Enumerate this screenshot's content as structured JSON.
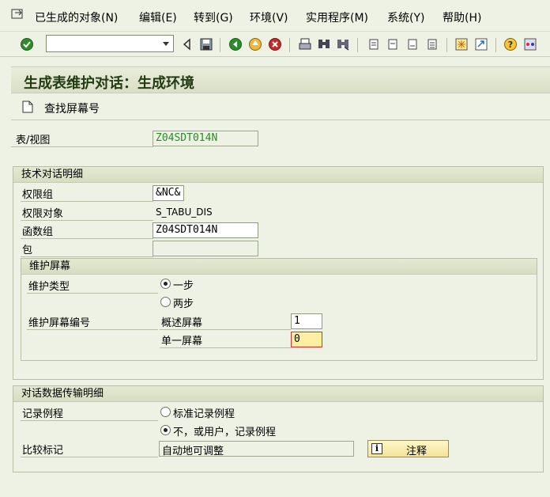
{
  "menu": {
    "items": [
      "已生成的对象(N)",
      "编辑(E)",
      "转到(G)",
      "环境(V)",
      "实用程序(M)",
      "系统(Y)",
      "帮助(H)"
    ]
  },
  "toolbar": {
    "command_value": "",
    "icons": [
      "check-icon",
      "back-icon",
      "save-icon",
      "nav-back-icon",
      "exit-icon",
      "cancel-icon",
      "print-icon",
      "find-icon",
      "find-next-icon",
      "first-page-icon",
      "prev-page-icon",
      "next-page-icon",
      "last-page-icon",
      "create-session-icon",
      "shortcut-icon",
      "help-icon",
      "layout-icon"
    ]
  },
  "title": "生成表维护对话：生成环境",
  "app_toolbar": {
    "find_screen_label": "查找屏幕号"
  },
  "table_view": {
    "label": "表/视图",
    "value": "Z04SDT014N"
  },
  "tech_group": {
    "title": "技术对话明细",
    "auth_group_label": "权限组",
    "auth_group_value": "&NC&",
    "auth_object_label": "权限对象",
    "auth_object_value": "S_TABU_DIS",
    "function_group_label": "函数组",
    "function_group_value": "Z04SDT014N",
    "package_label": "包",
    "package_value": ""
  },
  "maint_screen": {
    "title": "维护屏幕",
    "type_label": "维护类型",
    "one_step_label": "一步",
    "two_step_label": "两步",
    "screen_no_label": "维护屏幕编号",
    "overview_label": "概述屏幕",
    "overview_value": "1",
    "single_label": "单一屏幕",
    "single_value": "0"
  },
  "transfer_group": {
    "title": "对话数据传输明细",
    "routine_label": "记录例程",
    "standard_label": "标准记录例程",
    "no_user_label": "不，或用户，记录例程",
    "compare_label": "比较标记",
    "compare_value": "自动地可调整",
    "notes_button": "注释"
  }
}
